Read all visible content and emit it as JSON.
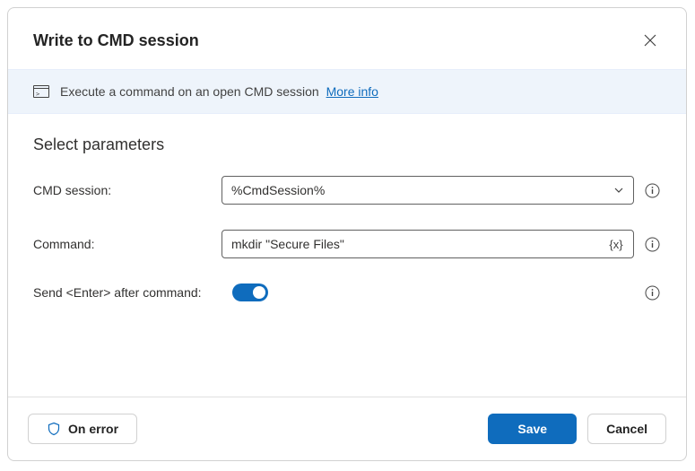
{
  "header": {
    "title": "Write to CMD session"
  },
  "banner": {
    "description": "Execute a command on an open CMD session",
    "more_info_label": "More info"
  },
  "section": {
    "title": "Select parameters"
  },
  "fields": {
    "cmd_session": {
      "label": "CMD session:",
      "value": "%CmdSession%"
    },
    "command": {
      "label": "Command:",
      "value": "mkdir \"Secure Files\""
    },
    "send_enter": {
      "label": "Send <Enter> after command:",
      "value": true
    }
  },
  "footer": {
    "on_error_label": "On error",
    "save_label": "Save",
    "cancel_label": "Cancel"
  }
}
